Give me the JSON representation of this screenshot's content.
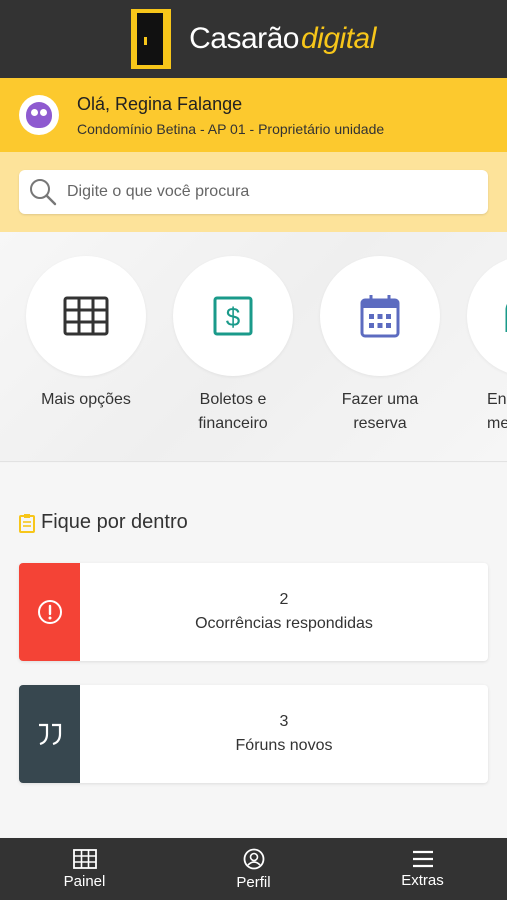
{
  "app": {
    "brand_main": "Casarão",
    "brand_accent": "digital"
  },
  "user": {
    "greeting": "Olá, Regina Falange",
    "subtitle": "Condomínio Betina - AP 01 - Proprietário unidade"
  },
  "search": {
    "placeholder": "Digite o que você procura"
  },
  "shortcuts": [
    {
      "icon": "grid-icon",
      "line1": "Mais opções",
      "line2": ""
    },
    {
      "icon": "dollar-document-icon",
      "line1": "Boletos e",
      "line2": "financeiro"
    },
    {
      "icon": "calendar-icon",
      "line1": "Fazer uma",
      "line2": "reserva"
    },
    {
      "icon": "partial-icon",
      "line1": "En",
      "line2": "me"
    }
  ],
  "section": {
    "title": "Fique por dentro",
    "icon": "clipboard-icon"
  },
  "cards": [
    {
      "count": "2",
      "text": "Ocorrências respondidas",
      "color": "#f44336",
      "icon": "alert-icon"
    },
    {
      "count": "3",
      "text": "Fóruns novos",
      "color": "#37474f",
      "icon": "quote-icon"
    }
  ],
  "bottom_nav": [
    {
      "label": "Painel",
      "icon": "grid-icon"
    },
    {
      "label": "Perfil",
      "icon": "user-circle-icon"
    },
    {
      "label": "Extras",
      "icon": "menu-icon"
    }
  ],
  "colors": {
    "accent": "#fcc92e",
    "dark": "#333333",
    "teal": "#1a9a8a",
    "indigo": "#5c6bc0"
  }
}
